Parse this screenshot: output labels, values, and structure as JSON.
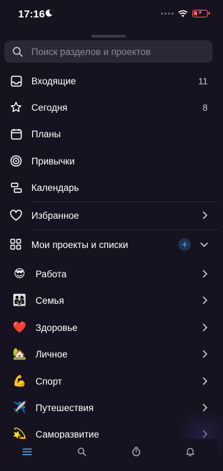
{
  "status": {
    "time": "17:16"
  },
  "search": {
    "placeholder": "Поиск разделов и проектов"
  },
  "menu": {
    "inbox": {
      "label": "Входящие",
      "count": "11"
    },
    "today": {
      "label": "Сегодня",
      "count": "8"
    },
    "plans": {
      "label": "Планы"
    },
    "habits": {
      "label": "Привычки"
    },
    "calendar": {
      "label": "Календарь"
    },
    "favorites": {
      "label": "Избранное"
    }
  },
  "projects": {
    "header": "Мои проекты и списки",
    "items": [
      {
        "label": "Работа",
        "emoji": "😎"
      },
      {
        "label": "Семья",
        "emoji": "👨‍👩‍👧"
      },
      {
        "label": "Здоровье",
        "emoji": "❤️"
      },
      {
        "label": "Личное",
        "emoji": "🏡"
      },
      {
        "label": "Спорт",
        "emoji": "💪"
      },
      {
        "label": "Путешествия",
        "emoji": "✈️"
      },
      {
        "label": "Саморазвитие",
        "emoji": "💫"
      }
    ]
  },
  "colors": {
    "background": "#16121f",
    "accent": "#5fa8f0",
    "search_bg": "#2b2734"
  },
  "bottom_nav": [
    "menu-icon",
    "search-icon",
    "timer-icon",
    "bell-icon"
  ]
}
